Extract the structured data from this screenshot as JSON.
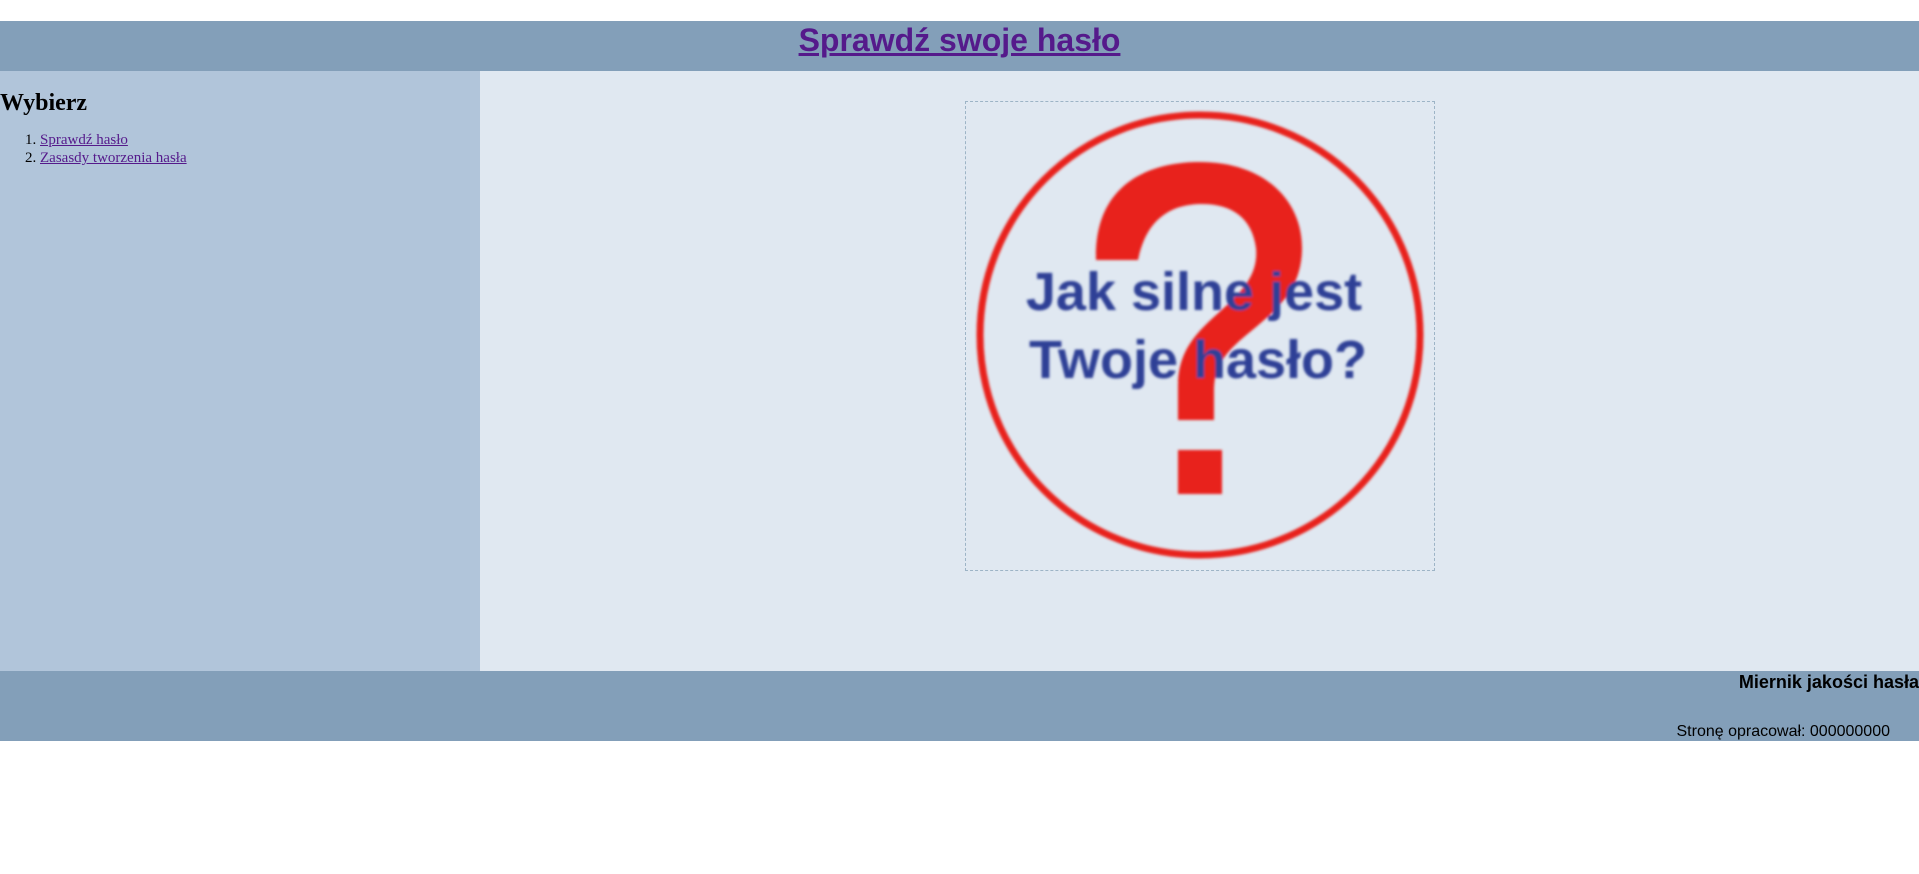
{
  "header": {
    "title": "Sprawdź swoje hasło"
  },
  "sidebar": {
    "heading": "Wybierz",
    "items": [
      {
        "label": "Sprawdź hasło"
      },
      {
        "label": "Zasasdy tworzenia hasła"
      }
    ]
  },
  "main": {
    "logo": {
      "icon": "question-mark-icon",
      "line1": "Jak silne jest",
      "line2": "Twoje hasło?",
      "colors": {
        "ring": "#e8211b",
        "text": "#2e4196"
      }
    }
  },
  "footer": {
    "title": "Miernik jakości hasła",
    "credit": "Stronę opracował: 000000000"
  },
  "colors": {
    "header_bg": "#839fb9",
    "sidebar_bg": "#b1c5da",
    "main_bg": "#e0e8f1",
    "link": "#551a8b"
  }
}
